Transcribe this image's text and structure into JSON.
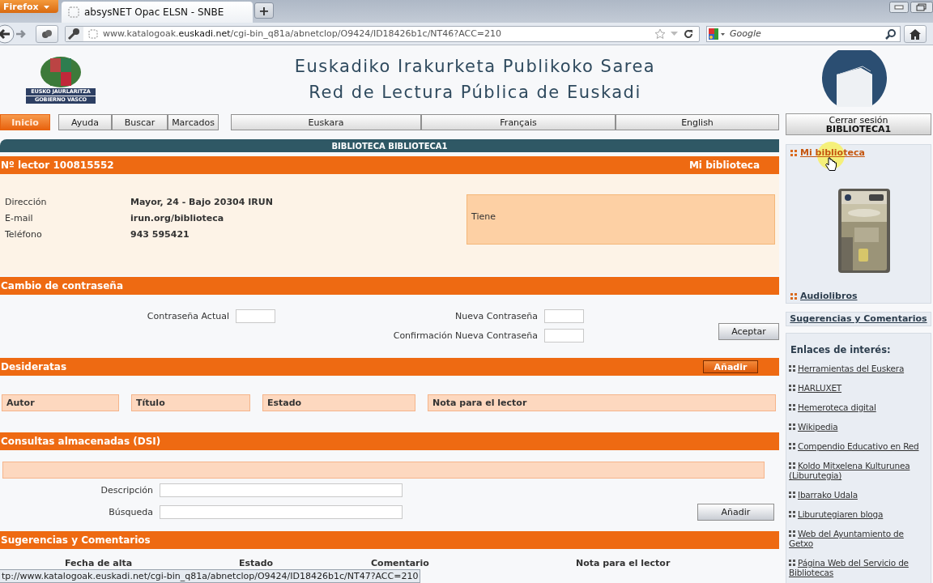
{
  "browser": {
    "menu_button": "Firefox",
    "tab_title": "absysNET Opac ELSN - SNBE",
    "new_tab": "+",
    "url": "www.katalogoak.**euskadi.net**/cgi-bin_q81a/abnetclop/O9424/ID18426b1c/NT46?ACC=210",
    "search_placeholder": "Google"
  },
  "header": {
    "logo_lines": [
      "EUSKO JAURLARITZA",
      "GOBIERNO VASCO"
    ],
    "title_lines": [
      "Euskadiko Irakurketa Publikoko Sarea",
      "Red de Lectura Pública de Euskadi"
    ]
  },
  "nav": {
    "items": [
      {
        "label": "Inicio",
        "selected": true
      },
      {
        "label": "Ayuda",
        "selected": false
      },
      {
        "label": "Buscar",
        "selected": false
      },
      {
        "label": "Marcados",
        "selected": false
      }
    ],
    "languages": [
      "Euskara",
      "Français",
      "English"
    ]
  },
  "logout": {
    "label": "Cerrar sesión",
    "user": "BIBLIOTECA1"
  },
  "main": {
    "library_bar": "BIBLIOTECA BIBLIOTECA1",
    "reader": {
      "title": "Nº lector 100815552",
      "link": "Mi biblioteca",
      "fields": [
        {
          "label": "Dirección",
          "value": "Mayor, 24 - Bajo 20304 IRUN"
        },
        {
          "label": "E-mail",
          "value": "irun.org/biblioteca"
        },
        {
          "label": "Teléfono",
          "value": "943 595421"
        }
      ],
      "note": "Tiene"
    },
    "password": {
      "title": "Cambio de contraseña",
      "fields": [
        "Contraseña Actual",
        "Nueva Contraseña",
        "Confirmación Nueva Contraseña"
      ],
      "button": "Aceptar"
    },
    "desiderata": {
      "title": "Desideratas",
      "button": "Añadir",
      "columns": [
        "Autor",
        "Título",
        "Estado",
        "Nota para el lector"
      ]
    },
    "dsi": {
      "title": "Consultas almacenadas (DSI)",
      "fields": [
        "Descripción",
        "Búsqueda"
      ],
      "button": "Añadir"
    },
    "suggestions": {
      "title": "Sugerencias y Comentarios",
      "columns": [
        "Fecha de alta",
        "Estado",
        "Comentario",
        "Nota para el lector"
      ]
    }
  },
  "sidebar": {
    "links": [
      {
        "label": "Mi biblioteca",
        "hovered": true
      },
      {
        "label": "Audiolibros",
        "hovered": false
      }
    ],
    "suggestions_link": "Sugerencias y Comentarios",
    "links_title": "Enlaces de interés:",
    "interest_links": [
      "Herramientas del Euskera",
      "HARLUXET",
      "Hemeroteca digital",
      "Wikipedia",
      "Compendio Educativo en Red",
      "Koldo Mitxelena Kulturunea (Liburutegia)",
      "Ibarrako Udala",
      "Liburutegiaren bloga",
      "Web del Ayuntamiento de Getxo",
      "Página Web del Servicio de Bibliotecas"
    ]
  },
  "status_bar": "tp://www.katalogoak.euskadi.net/cgi-bin_q81a/abnetclop/O9424/ID18426b1c/NT47?ACC=210"
}
